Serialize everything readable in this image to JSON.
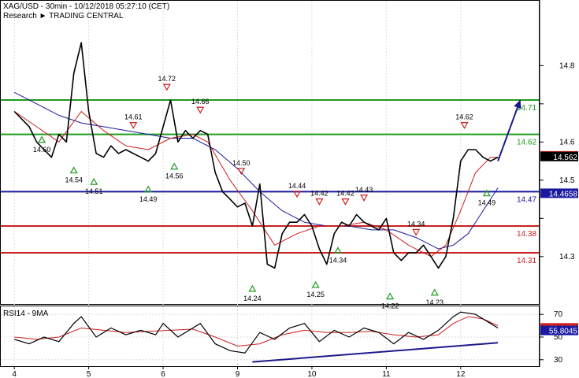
{
  "header": {
    "line1": "XAG/USD - 30min - 10/12/2018 05:27:10 (CET)",
    "line2": "Research ► TRADING CENTRAL"
  },
  "chart_data": {
    "type": "line",
    "instrument": "XAG/USD",
    "x_ticks": [
      "4",
      "5",
      "6",
      "9",
      "10",
      "11",
      "12"
    ],
    "price_axis": {
      "ylim": [
        14.18,
        14.91
      ],
      "ticks": [
        14.3,
        14.4,
        14.5,
        14.6,
        14.7,
        14.8
      ],
      "tick_labels": [
        "14.3",
        "14.5",
        "14.6",
        "14.8"
      ]
    },
    "horizontal_levels": [
      {
        "value": 14.71,
        "label": "14.71",
        "color": "#1e9a1e"
      },
      {
        "value": 14.62,
        "label": "14.62",
        "color": "#1e9a1e"
      },
      {
        "value": 14.47,
        "label": "14.47",
        "color": "#1a1aa0"
      },
      {
        "value": 14.38,
        "label": "14.38",
        "color": "#cc1f1f"
      },
      {
        "value": 14.31,
        "label": "14.31",
        "color": "#cc1f1f"
      }
    ],
    "current_price_tags": [
      {
        "value": 14.5638,
        "label": "14.5638",
        "color": "#cc1f1f"
      },
      {
        "value": 14.562,
        "label": "14.562",
        "color": "#000000"
      },
      {
        "value": 14.4658,
        "label": "14.4658",
        "color": "#1a1aa0"
      }
    ],
    "pivot_annotations": [
      {
        "label": "14.60",
        "type": "low",
        "day": 3.87,
        "value": 14.63
      },
      {
        "label": "14.54",
        "type": "low",
        "day": 4.3,
        "value": 14.55
      },
      {
        "label": "14.51",
        "type": "low",
        "day": 4.57,
        "value": 14.52
      },
      {
        "label": "14.49",
        "type": "low",
        "day": 5.3,
        "value": 14.5
      },
      {
        "label": "14.56",
        "type": "low",
        "day": 5.65,
        "value": 14.56
      },
      {
        "label": "14.61",
        "type": "high",
        "day": 5.1,
        "value": 14.62
      },
      {
        "label": "14.72",
        "type": "high",
        "day": 5.55,
        "value": 14.72
      },
      {
        "label": "14.66",
        "type": "high",
        "day": 6.0,
        "value": 14.66
      },
      {
        "label": "14.50",
        "type": "high",
        "day": 6.55,
        "value": 14.5
      },
      {
        "label": "14.24",
        "type": "low",
        "day": 6.7,
        "value": 14.24
      },
      {
        "label": "14.44",
        "type": "high",
        "day": 7.3,
        "value": 14.44
      },
      {
        "label": "14.42",
        "type": "high",
        "day": 7.6,
        "value": 14.42
      },
      {
        "label": "14.42",
        "type": "high",
        "day": 7.95,
        "value": 14.42
      },
      {
        "label": "14.43",
        "type": "high",
        "day": 8.2,
        "value": 14.43
      },
      {
        "label": "14.25",
        "type": "low",
        "day": 7.55,
        "value": 14.25
      },
      {
        "label": "14.34",
        "type": "low",
        "day": 7.85,
        "value": 14.34
      },
      {
        "label": "14.22",
        "type": "low",
        "day": 8.55,
        "value": 14.22
      },
      {
        "label": "14.34",
        "type": "high",
        "day": 8.9,
        "value": 14.34
      },
      {
        "label": "14.23",
        "type": "low",
        "day": 9.15,
        "value": 14.23
      },
      {
        "label": "14.62",
        "type": "high",
        "day": 9.55,
        "value": 14.62
      },
      {
        "label": "14.49",
        "type": "low",
        "day": 9.85,
        "value": 14.49
      }
    ],
    "projection_arrow": {
      "from_day": 10.0,
      "from_value": 14.55,
      "to_day": 10.3,
      "to_value": 14.71
    },
    "price_series": {
      "name": "",
      "color": "#000000",
      "days": [
        3.5,
        3.6,
        3.7,
        3.8,
        3.9,
        4.0,
        4.1,
        4.2,
        4.3,
        4.4,
        4.5,
        4.6,
        4.7,
        4.8,
        4.9,
        5.0,
        5.1,
        5.2,
        5.3,
        5.4,
        5.5,
        5.6,
        5.7,
        5.8,
        5.9,
        6.0,
        6.1,
        6.2,
        6.3,
        6.4,
        6.5,
        6.6,
        6.7,
        6.8,
        6.9,
        7.0,
        7.1,
        7.2,
        7.3,
        7.4,
        7.5,
        7.6,
        7.7,
        7.8,
        7.9,
        8.0,
        8.1,
        8.2,
        8.3,
        8.4,
        8.5,
        8.6,
        8.7,
        8.8,
        8.9,
        9.0,
        9.1,
        9.2,
        9.3,
        9.4,
        9.5,
        9.6,
        9.7,
        9.8,
        9.9,
        10.0
      ],
      "values": [
        14.68,
        14.66,
        14.64,
        14.6,
        14.58,
        14.56,
        14.62,
        14.6,
        14.78,
        14.86,
        14.68,
        14.57,
        14.56,
        14.59,
        14.57,
        14.58,
        14.57,
        14.56,
        14.55,
        14.57,
        14.64,
        14.71,
        14.6,
        14.63,
        14.61,
        14.63,
        14.62,
        14.52,
        14.47,
        14.45,
        14.43,
        14.44,
        14.38,
        14.49,
        14.28,
        14.27,
        14.36,
        14.39,
        14.39,
        14.41,
        14.38,
        14.32,
        14.28,
        14.36,
        14.39,
        14.38,
        14.41,
        14.39,
        14.38,
        14.37,
        14.4,
        14.31,
        14.29,
        14.31,
        14.31,
        14.33,
        14.3,
        14.27,
        14.3,
        14.4,
        14.55,
        14.58,
        14.58,
        14.56,
        14.55,
        14.56
      ]
    },
    "ma_fast": {
      "color": "#cc1f1f",
      "days": [
        3.5,
        3.8,
        4.1,
        4.4,
        4.7,
        5.0,
        5.3,
        5.6,
        5.9,
        6.1,
        6.4,
        6.7,
        7.0,
        7.3,
        7.6,
        7.9,
        8.2,
        8.5,
        8.8,
        9.1,
        9.3,
        9.5,
        9.7,
        9.9,
        10.0
      ],
      "values": [
        14.68,
        14.64,
        14.6,
        14.68,
        14.63,
        14.59,
        14.58,
        14.61,
        14.62,
        14.6,
        14.5,
        14.42,
        14.33,
        14.36,
        14.38,
        14.38,
        14.39,
        14.37,
        14.33,
        14.3,
        14.33,
        14.42,
        14.52,
        14.56,
        14.56
      ]
    },
    "ma_slow": {
      "color": "#1a1aa0",
      "days": [
        3.5,
        3.8,
        4.1,
        4.4,
        4.7,
        5.0,
        5.3,
        5.6,
        5.9,
        6.2,
        6.5,
        6.8,
        7.1,
        7.4,
        7.7,
        8.0,
        8.3,
        8.6,
        8.9,
        9.2,
        9.4,
        9.6,
        9.8,
        10.0
      ],
      "values": [
        14.73,
        14.7,
        14.67,
        14.65,
        14.64,
        14.63,
        14.62,
        14.61,
        14.61,
        14.58,
        14.53,
        14.47,
        14.42,
        14.39,
        14.38,
        14.38,
        14.37,
        14.37,
        14.35,
        14.32,
        14.33,
        14.36,
        14.42,
        14.48
      ]
    },
    "rsi_panel": {
      "title": "RSI14 - 9MA",
      "ylim": [
        25,
        75
      ],
      "ticks": [
        30,
        50,
        70
      ],
      "tick_labels": [
        "30",
        "50",
        "70"
      ],
      "value_tags": [
        {
          "value": 58.1153,
          "label": "58.1153",
          "color": "#cc1f1f"
        },
        {
          "value": 55.8045,
          "label": "55.8045",
          "color": "#1a1aa0"
        }
      ],
      "rsi_series": {
        "color": "#000000",
        "days": [
          3.5,
          3.7,
          3.9,
          4.1,
          4.3,
          4.4,
          4.6,
          4.8,
          5.0,
          5.2,
          5.4,
          5.5,
          5.7,
          5.9,
          6.0,
          6.2,
          6.4,
          6.6,
          6.8,
          7.0,
          7.2,
          7.4,
          7.6,
          7.8,
          8.0,
          8.2,
          8.4,
          8.6,
          8.8,
          9.0,
          9.2,
          9.4,
          9.5,
          9.7,
          9.9,
          10.0
        ],
        "values": [
          48,
          44,
          50,
          46,
          62,
          68,
          50,
          58,
          52,
          56,
          52,
          62,
          50,
          58,
          62,
          44,
          38,
          36,
          54,
          48,
          58,
          62,
          46,
          56,
          50,
          58,
          54,
          44,
          54,
          48,
          56,
          68,
          72,
          70,
          62,
          58
        ]
      },
      "ma_series": {
        "color": "#cc1f1f",
        "days": [
          3.5,
          3.8,
          4.1,
          4.4,
          4.7,
          5.0,
          5.3,
          5.6,
          5.9,
          6.2,
          6.5,
          6.8,
          7.1,
          7.4,
          7.7,
          8.0,
          8.3,
          8.6,
          8.9,
          9.2,
          9.4,
          9.6,
          9.8,
          10.0
        ],
        "values": [
          50,
          48,
          50,
          58,
          56,
          54,
          55,
          56,
          57,
          50,
          42,
          44,
          52,
          56,
          54,
          54,
          55,
          52,
          50,
          52,
          62,
          68,
          66,
          60
        ]
      },
      "trendline": {
        "from_day": 6.7,
        "from_value": 28,
        "to_day": 10.0,
        "to_value": 45
      }
    }
  }
}
